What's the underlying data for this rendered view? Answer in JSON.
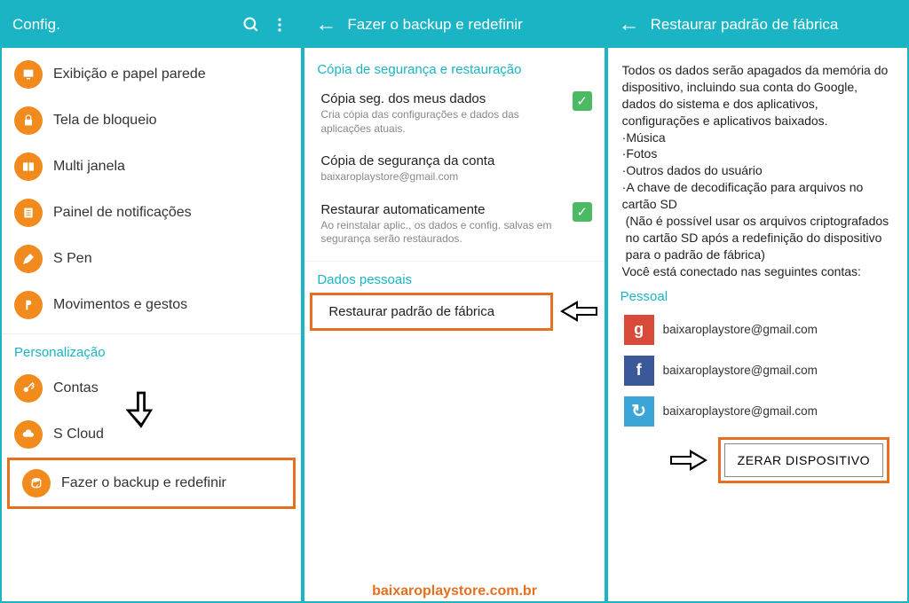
{
  "watermark": "baixaroplaystore.com.br",
  "screen1": {
    "title": "Config.",
    "items": [
      {
        "label": "Exibição e papel parede"
      },
      {
        "label": "Tela de bloqueio"
      },
      {
        "label": "Multi janela"
      },
      {
        "label": "Painel de notificações"
      },
      {
        "label": "S Pen"
      },
      {
        "label": "Movimentos e gestos"
      }
    ],
    "section": "Personalização",
    "subitems": [
      {
        "label": "Contas"
      },
      {
        "label": "S Cloud"
      },
      {
        "label": "Fazer o backup e redefinir"
      }
    ]
  },
  "screen2": {
    "title": "Fazer o backup e redefinir",
    "section1": "Cópia de segurança e restauração",
    "items": [
      {
        "title": "Cópia seg. dos meus dados",
        "sub": "Cria cópia das configurações e dados das aplicações atuais.",
        "check": true
      },
      {
        "title": "Cópia de segurança da conta",
        "sub": "baixaroplaystore@gmail.com",
        "check": false
      },
      {
        "title": "Restaurar automaticamente",
        "sub": "Ao reinstalar aplic., os dados e config. salvas em segurança serão restaurados.",
        "check": true
      }
    ],
    "section2": "Dados pessoais",
    "reset_item": "Restaurar padrão de fábrica"
  },
  "screen3": {
    "title": "Restaurar padrão de fábrica",
    "info": "Todos os dados serão apagados da memória do dispositivo, incluindo sua conta do Google, dados do sistema e dos aplicativos, configurações e aplicativos baixados.",
    "bullets": [
      "·Música",
      "·Fotos",
      "·Outros dados do usuário",
      "·A chave de decodificação para arquivos no cartão SD"
    ],
    "note": "(Não é possível usar os arquivos criptografados no cartão SD após a redefinição do dispositivo para o padrão de fábrica)",
    "connected": "Você está conectado nas seguintes contas:",
    "section": "Pessoal",
    "accounts": [
      {
        "email": "baixaroplaystore@gmail.com"
      },
      {
        "email": "baixaroplaystore@gmail.com"
      },
      {
        "email": "baixaroplaystore@gmail.com"
      }
    ],
    "button": "ZERAR DISPOSITIVO"
  }
}
